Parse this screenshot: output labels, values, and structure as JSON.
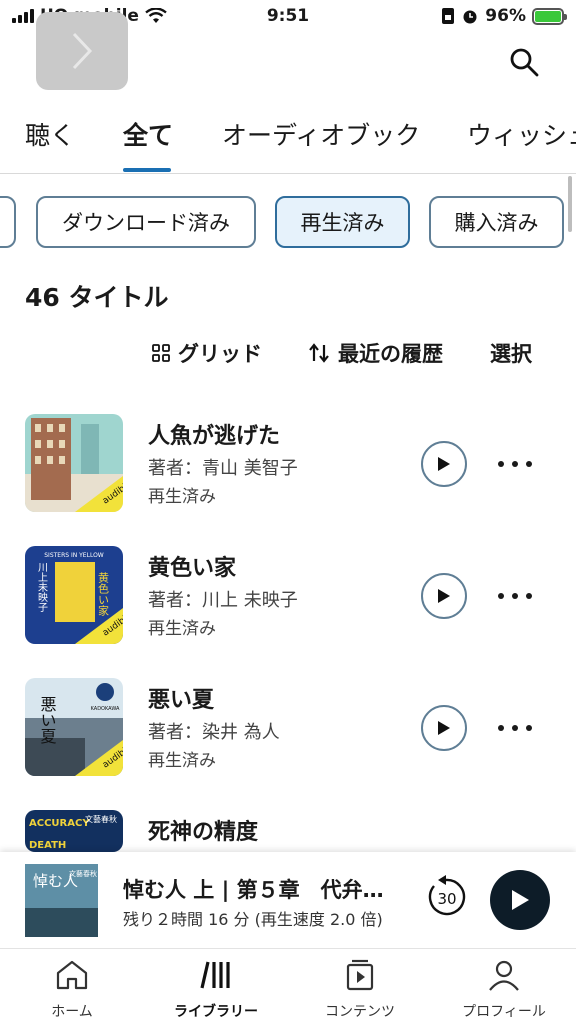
{
  "status_bar": {
    "carrier": "UQ mobile",
    "time": "9:51",
    "battery": "96%"
  },
  "tabs": [
    {
      "label": "聴く"
    },
    {
      "label": "全て"
    },
    {
      "label": "オーディオブック"
    },
    {
      "label": "ウィッシュ"
    }
  ],
  "filters": [
    {
      "label": "ダウンロード済み"
    },
    {
      "label": "再生済み"
    },
    {
      "label": "購入済み"
    }
  ],
  "count_text": "46 タイトル",
  "toolbar": {
    "grid": "グリッド",
    "sort": "最近の履歴",
    "select": "選択"
  },
  "items": [
    {
      "title": "人魚が逃げた",
      "author": "著者：青山 美智子",
      "status": "再生済み"
    },
    {
      "title": "黄色い家",
      "author": "著者：川上 未映子",
      "status": "再生済み"
    },
    {
      "title": "悪い夏",
      "author": "著者：染井 為人",
      "status": "再生済み"
    },
    {
      "title": "死神の精度",
      "author": "",
      "status": ""
    }
  ],
  "covers": {
    "c1_badge": "audible",
    "c2_en": "SISTERS IN YELLOW",
    "c2_title": "黄色い家",
    "c2_author": "川上未映子",
    "c2_badge": "audible",
    "c3_title": "悪い夏",
    "c3_pub": "KADOKAWA",
    "c3_badge": "audible",
    "c4_en": "ACCURACY",
    "c4_en2": "DEATH",
    "c4_jp": "文藝春秋",
    "mini_title": "悼む人",
    "mini_pub": "文藝春秋"
  },
  "mini_player": {
    "title": "悼む人 上 | 第５章　代弁…",
    "subtitle": "残り２時間 16 分 (再生速度 2.0 倍)",
    "rewind_seconds": "30"
  },
  "bottom_nav": [
    {
      "label": "ホーム"
    },
    {
      "label": "ライブラリー"
    },
    {
      "label": "コンテンツ"
    },
    {
      "label": "プロフィール"
    }
  ],
  "colors": {
    "accent": "#1a6fb3",
    "chip_border": "#5f7e95",
    "chip_active_bg": "#e6f2fb",
    "player_dark": "#0d1c28"
  }
}
